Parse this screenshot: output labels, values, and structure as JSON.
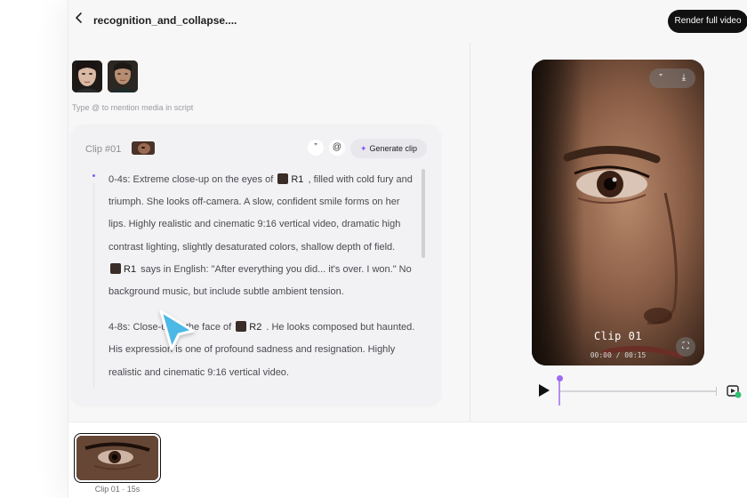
{
  "header": {
    "back_icon": "chevron-left-icon",
    "title": "recognition_and_collapse....",
    "render_label": "Render full video"
  },
  "media": {
    "avatars": [
      {
        "name": "woman-portrait"
      },
      {
        "name": "man-portrait"
      }
    ],
    "hint": "Type @ to mention media in script"
  },
  "clip_card": {
    "label": "Clip #01",
    "quote_icon": "quote-icon",
    "quote_glyph": "”",
    "mention_glyph": "@",
    "generate_label": "Generate clip",
    "paragraphs": [
      {
        "t1": "0-4s: Extreme close-up on the eyes of",
        "r1": "R1",
        "t2": ", filled with cold fury and triumph. She looks off-camera. A slow, confident smile forms on her lips. Highly realistic and cinematic 9:16 vertical video, dramatic high contrast lighting, slightly desaturated colors, shallow depth of field.",
        "r2": "R1",
        "t3": "says in English: \"After everything you did... it's over. I won.\" No background music, but include subtle ambient tension."
      },
      {
        "t1": "4-8s: Close-up of the face of",
        "r1": "R2",
        "t2": ". He looks composed but haunted. His expression is one of profound sadness and resignation. Highly realistic and cinematic 9:16 vertical video."
      }
    ]
  },
  "preview": {
    "title": "Clip 01",
    "time": "00:00 / 00:15",
    "progress": 0.0,
    "quote_glyph": "”",
    "download_glyph": "⤓",
    "fullscreen_glyph": "⛶",
    "play_icon": "play-icon",
    "volume_icon": "volume-icon"
  },
  "timeline": {
    "clips": [
      {
        "caption": "Clip 01 · 15s"
      }
    ]
  },
  "colors": {
    "accent": "#8a5cf6",
    "cursor": "#4bb8e6",
    "render_bg": "#111111"
  }
}
